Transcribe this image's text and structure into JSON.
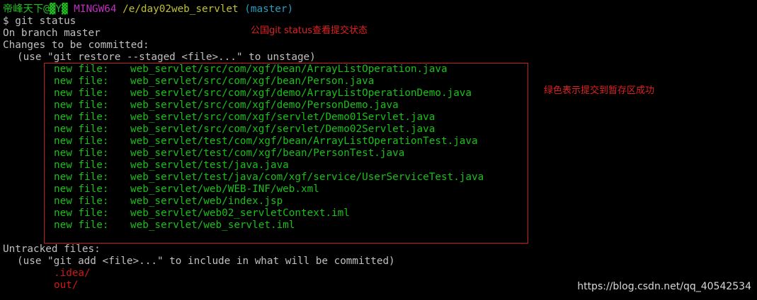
{
  "prompt": {
    "user_host": "帝峰天下@▓Y▓",
    "system": "MINGW64",
    "path": "/e/day02web_servlet",
    "branch": "(master)"
  },
  "command": "$ git status",
  "branch_line": "On branch master",
  "staged_header": "Changes to be committed:",
  "staged_hint": "(use \"git restore --staged <file>...\" to unstage)",
  "staged_label": "new file:",
  "staged_files": [
    "web_servlet/src/com/xgf/bean/ArrayListOperation.java",
    "web_servlet/src/com/xgf/bean/Person.java",
    "web_servlet/src/com/xgf/demo/ArrayListOperationDemo.java",
    "web_servlet/src/com/xgf/demo/PersonDemo.java",
    "web_servlet/src/com/xgf/servlet/Demo01Servlet.java",
    "web_servlet/src/com/xgf/servlet/Demo02Servlet.java",
    "web_servlet/test/com/xgf/bean/ArrayListOperationTest.java",
    "web_servlet/test/com/xgf/bean/PersonTest.java",
    "web_servlet/test/java.java",
    "web_servlet/test/java/com/xgf/service/UserServiceTest.java",
    "web_servlet/web/WEB-INF/web.xml",
    "web_servlet/web/index.jsp",
    "web_servlet/web02_servletContext.iml",
    "web_servlet/web_servlet.iml"
  ],
  "untracked_header": "Untracked files:",
  "untracked_hint": "(use \"git add <file>...\" to include in what will be committed)",
  "untracked_files": [
    ".idea/",
    "out/"
  ],
  "annotations": {
    "status_note": "公国git status查看提交状态",
    "staged_note": "绿色表示提交到暂存区成功"
  },
  "watermark": "https://blog.csdn.net/qq_40542534",
  "colors": {
    "background": "#000000",
    "text": "#c0c0c0",
    "staged": "#19c019",
    "untracked": "#d01818",
    "annotation": "#e02020"
  }
}
